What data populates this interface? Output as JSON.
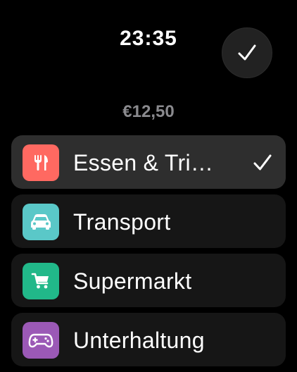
{
  "status": {
    "time": "23:35"
  },
  "confirm_button": {
    "icon": "checkmark-icon"
  },
  "amount": "€12,50",
  "categories": [
    {
      "label": "Essen & Tri…",
      "icon": "fork-knife-icon",
      "color": "#ff6961",
      "selected": true
    },
    {
      "label": "Transport",
      "icon": "car-icon",
      "color": "#5ac8c8",
      "selected": false
    },
    {
      "label": "Supermarkt",
      "icon": "shopping-cart-icon",
      "color": "#21b889",
      "selected": false
    },
    {
      "label": "Unterhaltung",
      "icon": "game-controller-icon",
      "color": "#9b59b6",
      "selected": false
    }
  ]
}
